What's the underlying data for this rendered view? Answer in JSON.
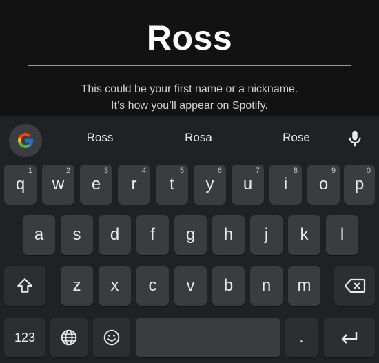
{
  "name_field": {
    "value": "Ross",
    "helper_line1": "This could be your first name or a nickname.",
    "helper_line2": "It’s how you’ll appear on Spotify."
  },
  "keyboard": {
    "suggestions": [
      "Ross",
      "Rosa",
      "Rose"
    ],
    "row1": [
      {
        "label": "q",
        "hint": "1"
      },
      {
        "label": "w",
        "hint": "2"
      },
      {
        "label": "e",
        "hint": "3"
      },
      {
        "label": "r",
        "hint": "4"
      },
      {
        "label": "t",
        "hint": "5"
      },
      {
        "label": "y",
        "hint": "6"
      },
      {
        "label": "u",
        "hint": "7"
      },
      {
        "label": "i",
        "hint": "8"
      },
      {
        "label": "o",
        "hint": "9"
      },
      {
        "label": "p",
        "hint": "0"
      }
    ],
    "row2": [
      "a",
      "s",
      "d",
      "f",
      "g",
      "h",
      "j",
      "k",
      "l"
    ],
    "row3": [
      "z",
      "x",
      "c",
      "v",
      "b",
      "n",
      "m"
    ],
    "symbols_label": "123",
    "period_label": ".",
    "icons": {
      "google": "google-g-icon",
      "mic": "microphone-icon",
      "shift": "shift-arrow-icon",
      "backspace": "backspace-icon",
      "globe": "globe-icon",
      "emoji": "emoji-icon",
      "enter": "enter-arrow-icon"
    },
    "colors": {
      "background": "#202124",
      "key": "#3b3c40",
      "function_key": "#2d2e31",
      "page_background": "#121212"
    }
  }
}
